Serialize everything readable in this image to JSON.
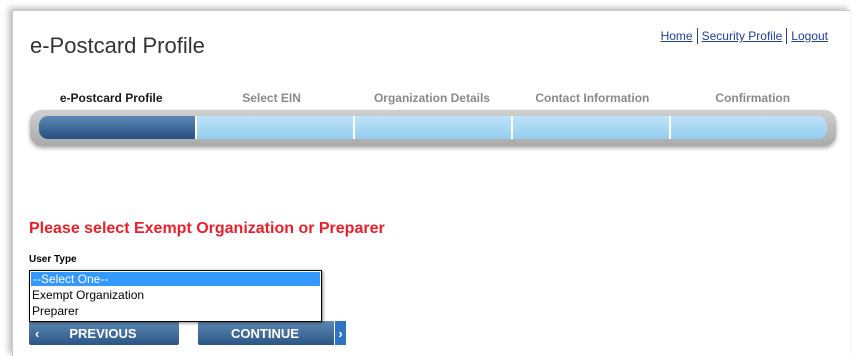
{
  "header": {
    "title": "e-Postcard Profile",
    "nav": [
      {
        "label": "Home"
      },
      {
        "label": "Security Profile"
      },
      {
        "label": "Logout"
      }
    ]
  },
  "steps": [
    {
      "label": "e-Postcard Profile",
      "active": true
    },
    {
      "label": "Select EIN",
      "active": false
    },
    {
      "label": "Organization Details",
      "active": false
    },
    {
      "label": "Contact Information",
      "active": false
    },
    {
      "label": "Confirmation",
      "active": false
    }
  ],
  "form": {
    "prompt": "Please select Exempt Organization or Preparer",
    "user_type_label": "User Type",
    "user_type_options": [
      "--Select One--",
      "Exempt Organization",
      "Preparer"
    ],
    "selected_option": "--Select One--"
  },
  "buttons": {
    "previous_label": "PREVIOUS",
    "continue_label": "CONTINUE",
    "previous_arrow": "‹",
    "continue_arrow": "›"
  },
  "colors": {
    "prompt": "#e8202a",
    "active_step": "#264f7f",
    "inactive_step": "#93cdef",
    "link": "#1f3f9a",
    "selected_option_bg": "#3399ff"
  }
}
